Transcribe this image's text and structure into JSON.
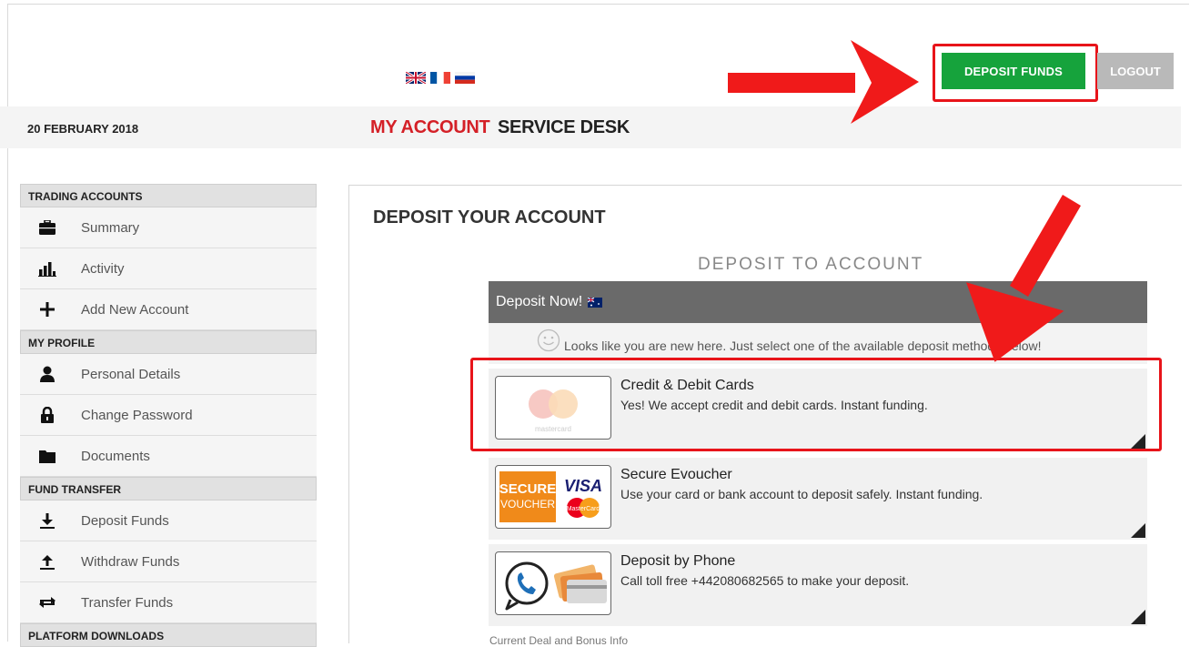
{
  "header": {
    "flags": [
      {
        "name": "uk-flag-icon",
        "colors": [
          "#012169",
          "#ffffff",
          "#c8102e"
        ]
      },
      {
        "name": "france-flag-icon",
        "colors": [
          "#0055a4",
          "#ffffff",
          "#ef4135"
        ]
      },
      {
        "name": "russia-flag-icon",
        "colors": [
          "#ffffff",
          "#0039a6",
          "#d52b1e"
        ]
      }
    ],
    "deposit_button": "DEPOSIT FUNDS",
    "logout_button": "LOGOUT",
    "accent_green": "#16a33c",
    "highlight_red": "#e8141a"
  },
  "nav": {
    "date": "20 FEBRUARY 2018",
    "my_account": "MY ACCOUNT",
    "service_desk": "SERVICE DESK"
  },
  "sidebar": {
    "sections": [
      {
        "title": "TRADING ACCOUNTS",
        "items": [
          {
            "label": "Summary",
            "icon": "briefcase-icon"
          },
          {
            "label": "Activity",
            "icon": "bar-chart-icon"
          },
          {
            "label": "Add New Account",
            "icon": "plus-icon"
          }
        ]
      },
      {
        "title": "MY PROFILE",
        "items": [
          {
            "label": "Personal Details",
            "icon": "user-icon"
          },
          {
            "label": "Change Password",
            "icon": "lock-icon"
          },
          {
            "label": "Documents",
            "icon": "folder-icon"
          }
        ]
      },
      {
        "title": "FUND TRANSFER",
        "items": [
          {
            "label": "Deposit Funds",
            "icon": "download-icon"
          },
          {
            "label": "Withdraw Funds",
            "icon": "upload-icon"
          },
          {
            "label": "Transfer Funds",
            "icon": "transfer-icon"
          }
        ]
      },
      {
        "title": "PLATFORM DOWNLOADS",
        "items": []
      }
    ]
  },
  "main": {
    "title": "DEPOSIT YOUR ACCOUNT",
    "subtitle": "DEPOSIT TO ACCOUNT",
    "deposit_now": "Deposit Now!",
    "notice": "Looks like you are new here. Just select one of the available deposit methods below!",
    "methods": [
      {
        "title": "Credit & Debit Cards",
        "desc": "Yes! We accept credit and debit cards. Instant funding.",
        "logo": "mastercard-logo",
        "logo_text": "mastercard"
      },
      {
        "title": "Secure Evoucher",
        "desc": "Use your card or bank account to deposit safely. Instant funding.",
        "logo": "secure-voucher-logo",
        "logo_text_1": "SECURE",
        "logo_text_2": "VOUCHER",
        "logo_text_3": "VISA",
        "logo_text_4": "MasterCard"
      },
      {
        "title": "Deposit by Phone",
        "desc": "Call toll free +442080682565 to make your deposit.",
        "logo": "phone-cards-logo"
      }
    ],
    "footer": "Current Deal and Bonus Info"
  }
}
